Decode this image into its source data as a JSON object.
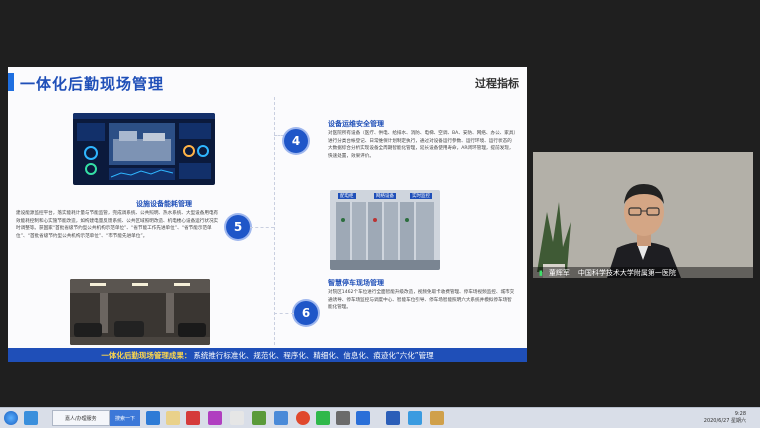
{
  "slide": {
    "title": "一体化后勤现场管理",
    "corner_label": "过程指标",
    "sections": [
      {
        "number": "4",
        "title": "设备运维安全管理",
        "body": "对医院所有设备（医疗、供电、给排水、消防、电梯、空调、BA、安防、网络、办公、家具）进行分类台帐登记、日常维保计划制定执行，通过对设备运行参数、运行环境、运行状态的大数据综合分析实现设备全周期智能化管理，延长设备使用寿命，AR闭环管理，提前发现，快速处置，效果评价。"
      },
      {
        "number": "5",
        "title": "设施设备能耗管理",
        "body": "建设能源监控平台，落实能耗计量与节能监管，完成调系统、公共照明、热水系统、大型设备用电有效能耗控制和心实施节能改造，如构建电量反馈系统、公共区域照明改造、机电楼心设备运行状况实时调整等。获国家“首批省级节约型公共机构示范单位”、“省节能工作先进单位”、“省节能示范单位”、“首批省级节约型公共机构示范单位”、“市节能先进单位”。"
      },
      {
        "number": "6",
        "title": "智慧停车现场管理",
        "body": "对院区1462个车位进行全面智能升级改造，视频免取卡收费管理、停车场视频监控、城市交通诱导、停车场监控与调度中心、智能车位引导、停车场智能照明六大系统并模拟停车场智能化管理。"
      }
    ],
    "footer_highlight": "一体化后勤现场管理成果：",
    "footer_text": "系统推行标准化、规范化、程序化、精细化、信息化、痕迹化“六化”管理",
    "panel_labels": [
      "配电柜",
      "网络设备",
      "实时监控"
    ]
  },
  "webcam": {
    "name": "董辉军",
    "affiliation": "中国科学技术大学附属第一医院"
  },
  "taskbar": {
    "task_label": "嘉人/办理服务",
    "search_label": "搜索一下",
    "time": "9:28",
    "date": "2020/6/27 星期六"
  },
  "colors": {
    "accent": "#1f4fb8",
    "highlight": "#ffd84a"
  }
}
